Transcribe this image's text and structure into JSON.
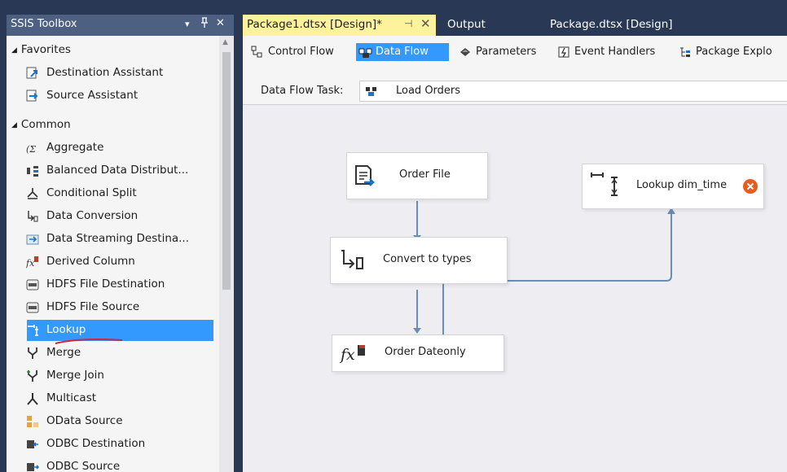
{
  "toolbox": {
    "title": "SSIS Toolbox",
    "dropdown_glyph": "▾",
    "pin_glyph": "ᴙ",
    "close_glyph": "✕",
    "groups": [
      {
        "label": "Favorites",
        "items": [
          {
            "label": "Destination Assistant",
            "icon": "destination-assistant-icon"
          },
          {
            "label": "Source Assistant",
            "icon": "source-assistant-icon"
          }
        ]
      },
      {
        "label": "Common",
        "items": [
          {
            "label": "Aggregate",
            "icon": "aggregate-icon"
          },
          {
            "label": "Balanced Data Distribut...",
            "icon": "balanced-data-distributor-icon"
          },
          {
            "label": "Conditional Split",
            "icon": "conditional-split-icon"
          },
          {
            "label": "Data Conversion",
            "icon": "data-conversion-icon"
          },
          {
            "label": "Data Streaming Destina...",
            "icon": "data-streaming-destination-icon"
          },
          {
            "label": "Derived Column",
            "icon": "derived-column-icon"
          },
          {
            "label": "HDFS File Destination",
            "icon": "hdfs-file-destination-icon"
          },
          {
            "label": "HDFS File Source",
            "icon": "hdfs-file-source-icon"
          },
          {
            "label": "Lookup",
            "icon": "lookup-icon",
            "selected": true
          },
          {
            "label": "Merge",
            "icon": "merge-icon"
          },
          {
            "label": "Merge Join",
            "icon": "merge-join-icon"
          },
          {
            "label": "Multicast",
            "icon": "multicast-icon"
          },
          {
            "label": "OData Source",
            "icon": "odata-source-icon"
          },
          {
            "label": "ODBC Destination",
            "icon": "odbc-destination-icon"
          },
          {
            "label": "ODBC Source",
            "icon": "odbc-source-icon"
          }
        ]
      }
    ]
  },
  "doc_tabs": [
    {
      "label": "Package1.dtsx [Design]*",
      "active": true,
      "pin_glyph": "⊣",
      "close_glyph": "✕"
    },
    {
      "label": "Output",
      "active": false
    },
    {
      "label": "Package.dtsx [Design]",
      "active": false
    }
  ],
  "designer_tabs": [
    {
      "label": "Control Flow",
      "icon": "control-flow-icon"
    },
    {
      "label": "Data Flow",
      "icon": "data-flow-icon",
      "active": true
    },
    {
      "label": "Parameters",
      "icon": "parameters-icon"
    },
    {
      "label": "Event Handlers",
      "icon": "event-handlers-icon"
    },
    {
      "label": "Package Explo",
      "icon": "package-explorer-icon"
    }
  ],
  "task": {
    "label": "Data Flow Task:",
    "value": "Load Orders"
  },
  "nodes": [
    {
      "label": "Order File",
      "icon": "flat-file-source-icon"
    },
    {
      "label": "Convert to types",
      "icon": "data-conversion-icon"
    },
    {
      "label": "Order Dateonly",
      "icon": "derived-column-icon"
    },
    {
      "label": "Lookup dim_time",
      "icon": "lookup-icon",
      "status": "error",
      "status_icon": "error-icon"
    }
  ],
  "colors": {
    "chrome": "#293955",
    "tab_active": "#fff29d",
    "selection": "#3399ff",
    "connector": "#6b8cb5",
    "error": "#e85d1f",
    "annotation": "#d9232e"
  }
}
